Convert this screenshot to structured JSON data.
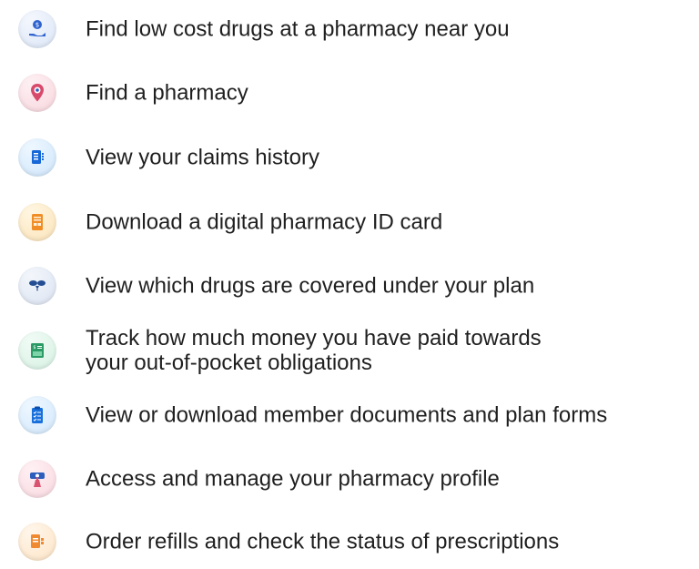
{
  "features": [
    {
      "label": "Find low cost drugs at a pharmacy near you",
      "icon": "hand-dollar-icon",
      "accent": "#2f63cf",
      "bg": "#dbe6f7"
    },
    {
      "label": "Find a pharmacy",
      "icon": "location-pin-icon",
      "accent": "#d84a6b",
      "bg": "#f8d7de"
    },
    {
      "label": "View your claims history",
      "icon": "document-list-icon",
      "accent": "#1667d7",
      "bg": "#cfe6fb"
    },
    {
      "label": "Download a digital pharmacy ID card",
      "icon": "id-card-icon",
      "accent": "#f08d25",
      "bg": "#fbe3b8"
    },
    {
      "label": "View which drugs are covered under your plan",
      "icon": "pills-icon",
      "accent": "#244e93",
      "bg": "#dbe4f2"
    },
    {
      "label": "Track how much money you have paid towards\nyour out-of-pocket obligations",
      "icon": "money-ledger-icon",
      "accent": "#2a9b65",
      "bg": "#d7f1e4"
    },
    {
      "label": "View or download member documents and plan forms",
      "icon": "clipboard-check-icon",
      "accent": "#1770dc",
      "bg": "#d2e8fc"
    },
    {
      "label": "Access and manage your pharmacy profile",
      "icon": "touch-profile-icon",
      "accent": "#d95370",
      "bg": "#f8d9e0"
    },
    {
      "label": "Order refills and check the status of prescriptions",
      "icon": "prescription-order-icon",
      "accent": "#f08a31",
      "bg": "#fde4c5"
    }
  ]
}
